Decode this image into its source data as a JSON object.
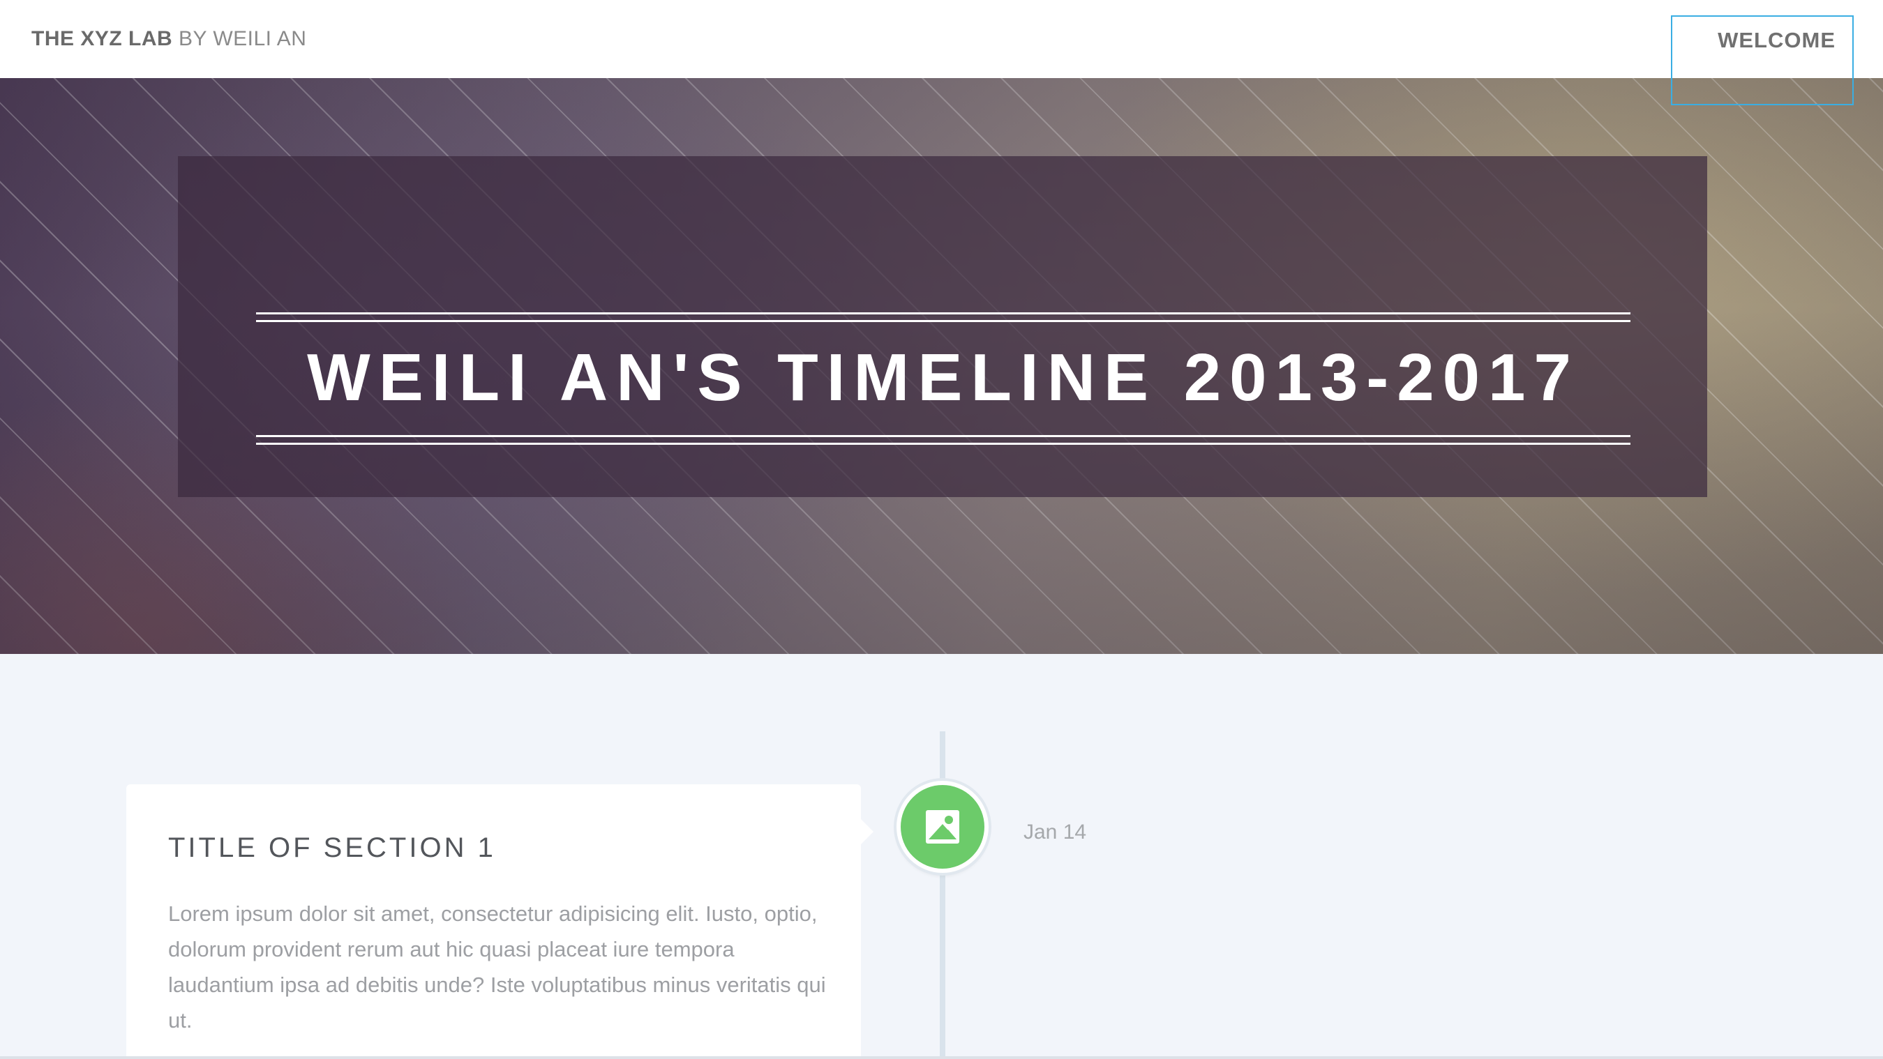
{
  "navbar": {
    "brand_strong": "THE XYZ LAB",
    "brand_light": "BY WEILI AN",
    "welcome_label": "WELCOME"
  },
  "hero": {
    "title": "WEILI AN'S TIMELINE 2013-2017"
  },
  "timeline": {
    "items": [
      {
        "icon": "picture-icon",
        "icon_color": "#6ccb6a",
        "date": "Jan 14",
        "title": "TITLE OF SECTION 1",
        "body": "Lorem ipsum dolor sit amet, consectetur adipisicing elit. Iusto, optio, dolorum provident rerum aut hic quasi placeat iure tempora laudantium ipsa ad debitis unde? Iste voluptatibus minus veritatis qui ut."
      }
    ]
  },
  "colors": {
    "focus_outline": "#3aaee3",
    "node_green": "#6ccb6a",
    "page_background": "#f2f5fa"
  }
}
